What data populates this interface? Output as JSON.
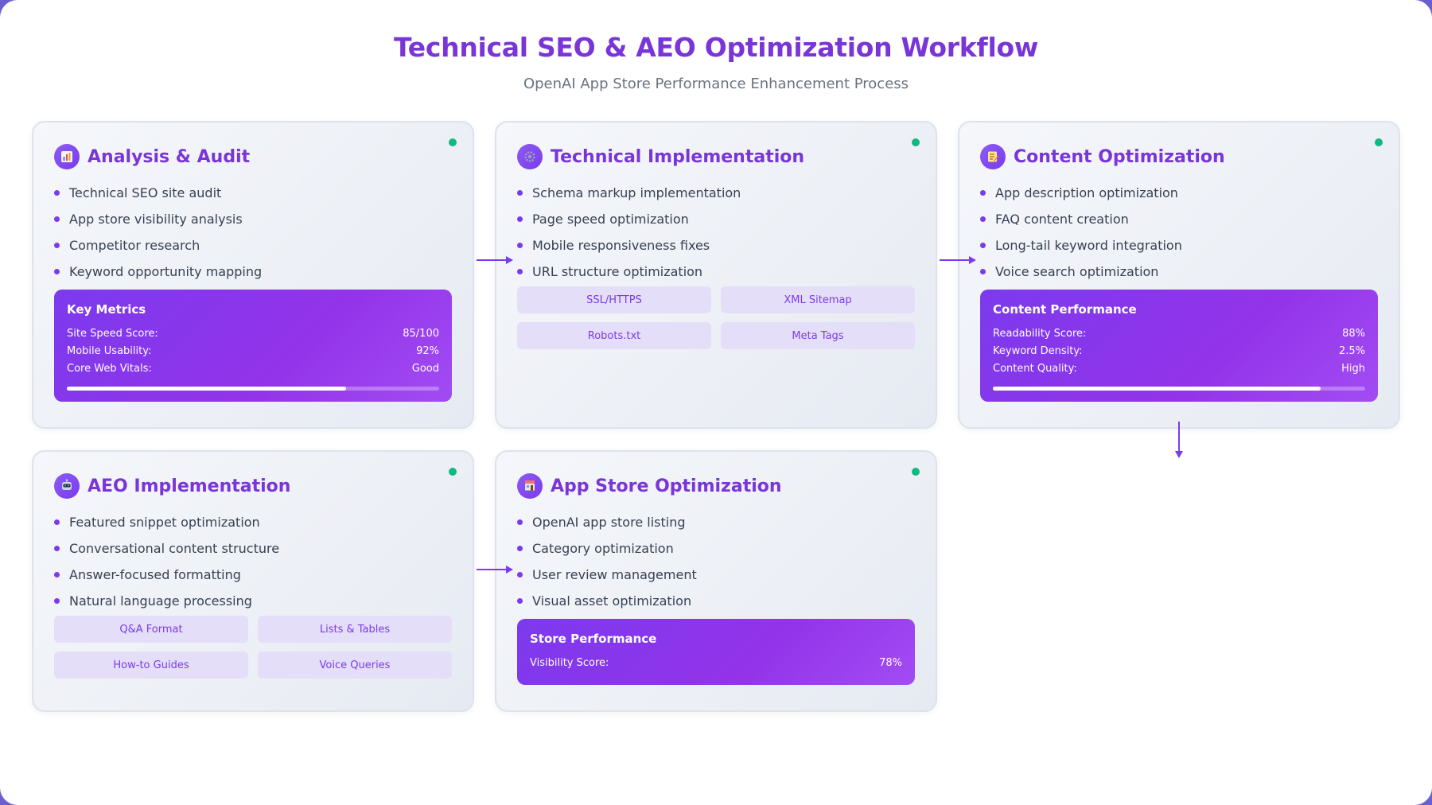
{
  "header": {
    "title": "Technical SEO & AEO Optimization Workflow",
    "subtitle": "OpenAI App Store Performance Enhancement Process"
  },
  "colors": {
    "accent": "#7a35d8",
    "status": "#10b981",
    "panel_gradient_start": "#7c3aed",
    "panel_gradient_end": "#a24cf3",
    "tag_bg": "#e4def8"
  },
  "cards": [
    {
      "icon": "bar-chart-icon",
      "title": "Analysis & Audit",
      "items": [
        "Technical SEO site audit",
        "App store visibility analysis",
        "Competitor research",
        "Keyword opportunity mapping"
      ],
      "panel": {
        "title": "Key Metrics",
        "rows": [
          {
            "label": "Site Speed Score:",
            "value": "85/100"
          },
          {
            "label": "Mobile Usability:",
            "value": "92%"
          },
          {
            "label": "Core Web Vitals:",
            "value": "Good"
          }
        ],
        "progress": 0.75
      }
    },
    {
      "icon": "gear-icon",
      "title": "Technical Implementation",
      "items": [
        "Schema markup implementation",
        "Page speed optimization",
        "Mobile responsiveness fixes",
        "URL structure optimization"
      ],
      "tags": [
        "SSL/HTTPS",
        "XML Sitemap",
        "Robots.txt",
        "Meta Tags"
      ]
    },
    {
      "icon": "memo-icon",
      "title": "Content Optimization",
      "items": [
        "App description optimization",
        "FAQ content creation",
        "Long-tail keyword integration",
        "Voice search optimization"
      ],
      "panel": {
        "title": "Content Performance",
        "rows": [
          {
            "label": "Readability Score:",
            "value": "88%"
          },
          {
            "label": "Keyword Density:",
            "value": "2.5%"
          },
          {
            "label": "Content Quality:",
            "value": "High"
          }
        ],
        "progress": 0.88
      }
    },
    {
      "icon": "robot-icon",
      "title": "AEO Implementation",
      "items": [
        "Featured snippet optimization",
        "Conversational content structure",
        "Answer-focused formatting",
        "Natural language processing"
      ],
      "tags": [
        "Q&A Format",
        "Lists & Tables",
        "How-to Guides",
        "Voice Queries"
      ]
    },
    {
      "icon": "store-icon",
      "title": "App Store Optimization",
      "items": [
        "OpenAI app store listing",
        "Category optimization",
        "User review management",
        "Visual asset optimization"
      ],
      "panel": {
        "title": "Store Performance",
        "rows": [
          {
            "label": "Visibility Score:",
            "value": "78%"
          }
        ]
      }
    }
  ]
}
